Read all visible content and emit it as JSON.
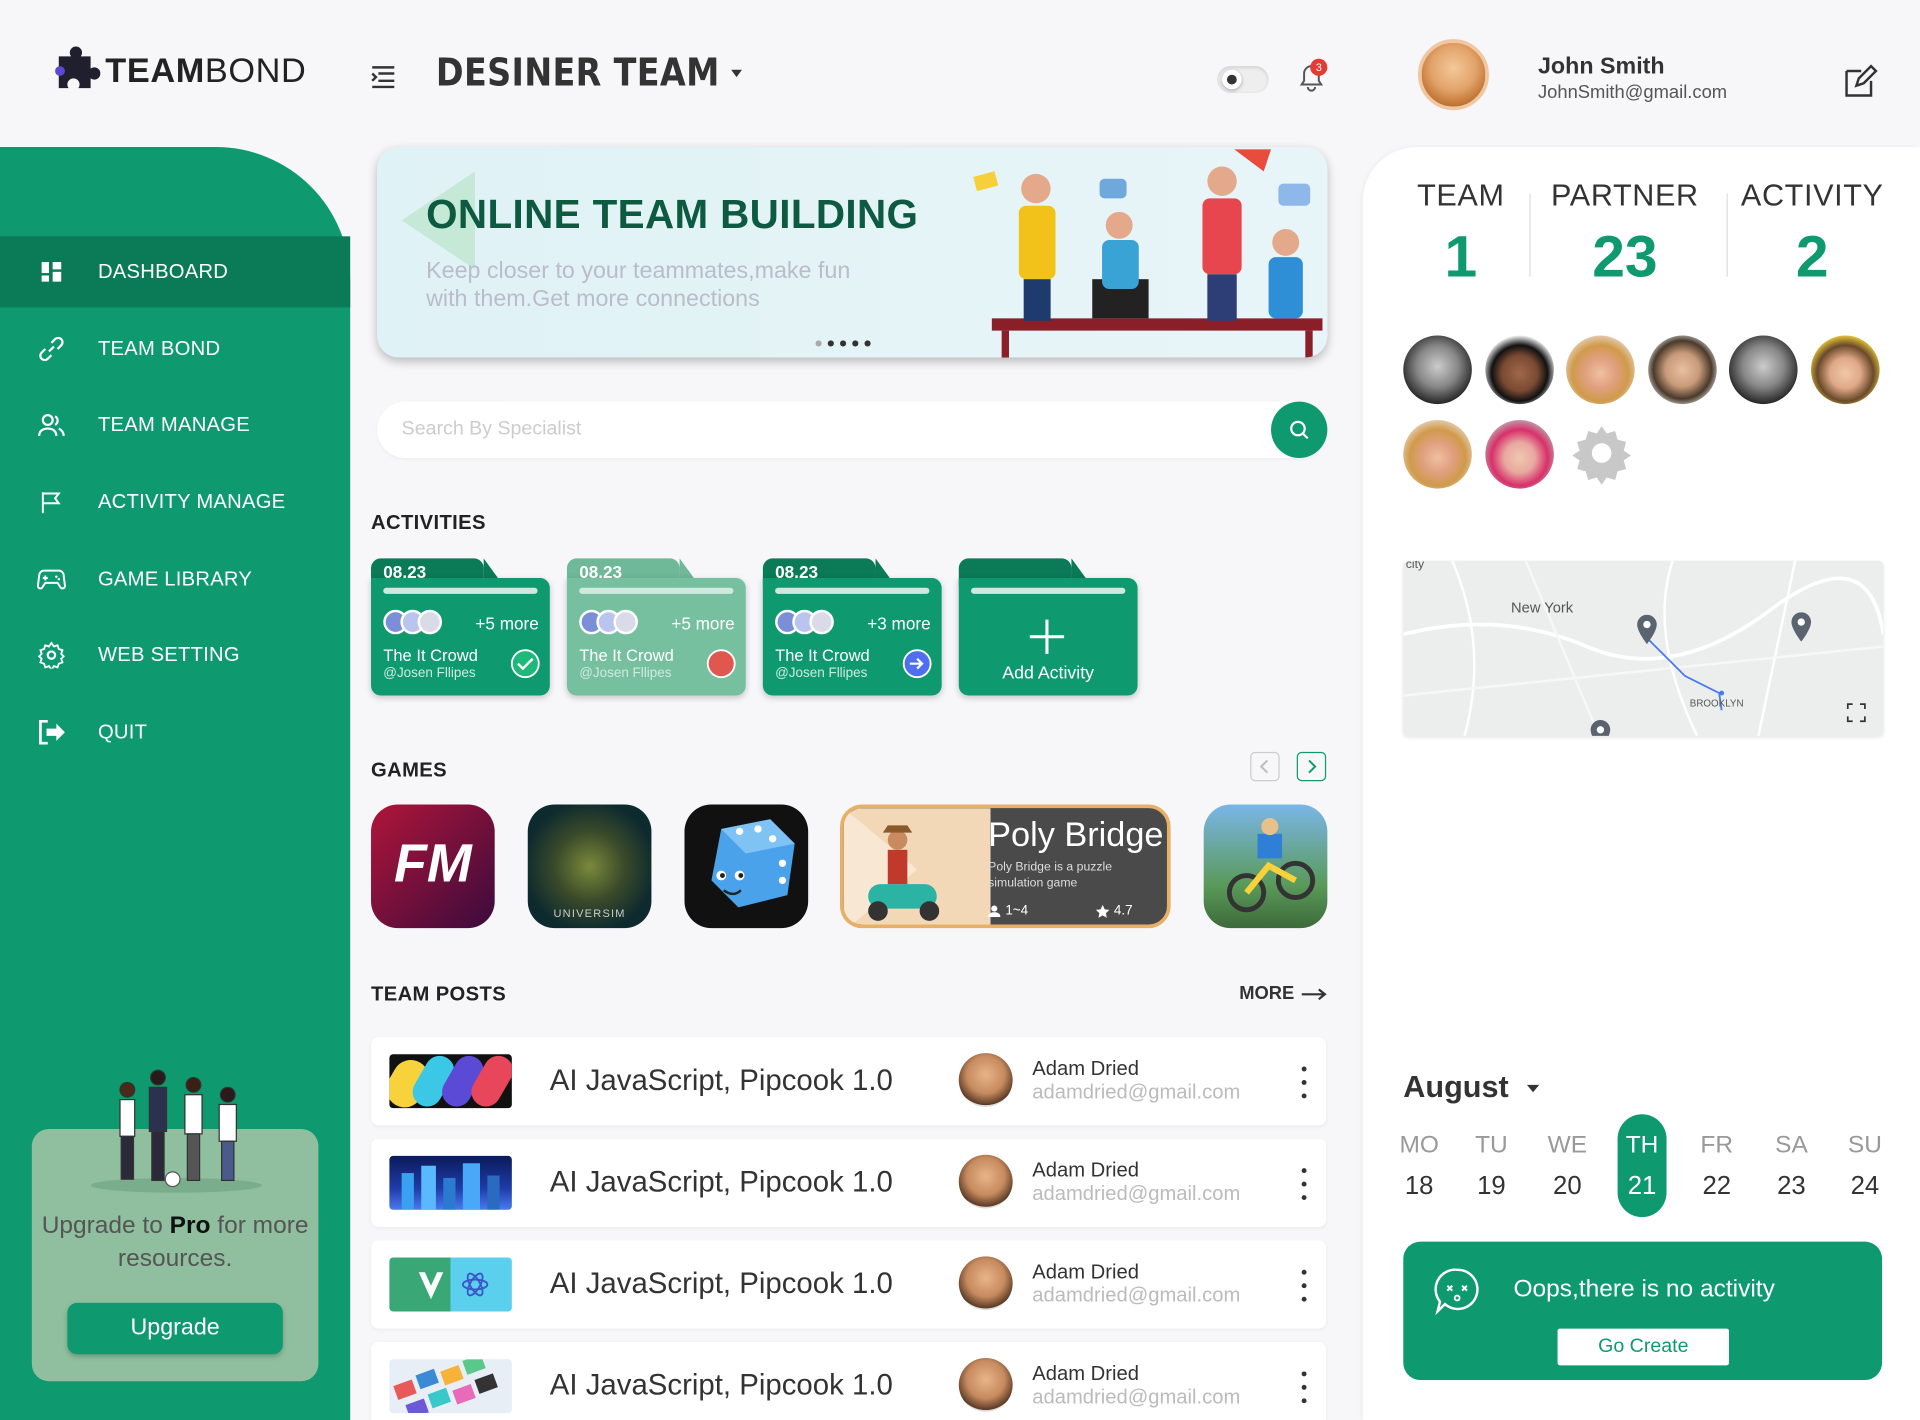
{
  "brand": {
    "name_bold": "TEAM",
    "name_light": "BOND"
  },
  "header": {
    "team_title": "DESINER TEAM",
    "notification_count": "3",
    "user": {
      "name": "John Smith",
      "email": "JohnSmith@gmail.com"
    }
  },
  "sidebar": {
    "items": [
      {
        "label": "DASHBOARD",
        "icon": "dashboard-icon"
      },
      {
        "label": "TEAM BOND",
        "icon": "link-icon"
      },
      {
        "label": "TEAM MANAGE",
        "icon": "users-icon"
      },
      {
        "label": "ACTIVITY MANAGE",
        "icon": "flag-icon"
      },
      {
        "label": "GAME LIBRARY",
        "icon": "gamepad-icon"
      },
      {
        "label": "WEB SETTING",
        "icon": "gear-icon"
      },
      {
        "label": "QUIT",
        "icon": "logout-icon"
      }
    ],
    "upgrade": {
      "text_before": "Upgrade to ",
      "text_pro": "Pro",
      "text_after": " for more resources.",
      "button": "Upgrade"
    }
  },
  "banner": {
    "title": "ONLINE TEAM BUILDING",
    "subtitle": "Keep closer to your teammates,make fun with them.Get more connections"
  },
  "search": {
    "placeholder": "Search By Specialist"
  },
  "activities": {
    "title": "ACTIVITIES",
    "cards": [
      {
        "date": "08.23",
        "more": "+5 more",
        "name": "The It Crowd",
        "user": "@Josen Fllipes",
        "status": "completed"
      },
      {
        "date": "08.23",
        "more": "+5 more",
        "name": "The It Crowd",
        "user": "@Josen Fllipes",
        "status": "cancelled"
      },
      {
        "date": "08.23",
        "more": "+3 more",
        "name": "The It Crowd",
        "user": "@Josen Fllipes",
        "status": "pending"
      }
    ],
    "add_label": "Add Activity"
  },
  "games": {
    "title": "GAMES",
    "featured": {
      "title": "Poly Bridge",
      "description": "Poly Bridge is a puzzle simulation game",
      "players": "1~4",
      "rating": "4.7"
    },
    "fm_label": "FM",
    "universim_label": "UNIVERSIM"
  },
  "posts": {
    "title": "TEAM POSTS",
    "more": "MORE",
    "items": [
      {
        "title": "AI JavaScript, Pipcook 1.0",
        "author": "Adam Dried",
        "email": "adamdried@gmail.com"
      },
      {
        "title": "AI JavaScript, Pipcook 1.0",
        "author": "Adam Dried",
        "email": "adamdried@gmail.com"
      },
      {
        "title": "AI JavaScript, Pipcook 1.0",
        "author": "Adam Dried",
        "email": "adamdried@gmail.com"
      },
      {
        "title": "AI JavaScript, Pipcook 1.0",
        "author": "Adam Dried",
        "email": "adamdried@gmail.com"
      }
    ]
  },
  "stats": [
    {
      "label": "TEAM",
      "value": "1"
    },
    {
      "label": "PARTNER",
      "value": "23"
    },
    {
      "label": "ACTIVITY",
      "value": "2"
    }
  ],
  "map": {
    "labels": [
      "New York",
      "BROOKLYN",
      "city"
    ]
  },
  "calendar": {
    "month": "August",
    "days": [
      {
        "name": "MO",
        "num": "18"
      },
      {
        "name": "TU",
        "num": "19"
      },
      {
        "name": "WE",
        "num": "20"
      },
      {
        "name": "TH",
        "num": "21"
      },
      {
        "name": "FR",
        "num": "22"
      },
      {
        "name": "SA",
        "num": "23"
      },
      {
        "name": "SU",
        "num": "24"
      }
    ],
    "selected_index": 3
  },
  "empty_activity": {
    "text": "Oops,there is no activity",
    "button": "Go Create"
  },
  "colors": {
    "primary": "#0e9a6e",
    "primary_dark": "#0a7a57",
    "completed": "#1db87a",
    "cancelled": "#e0574f",
    "pending": "#4f6ef0"
  }
}
